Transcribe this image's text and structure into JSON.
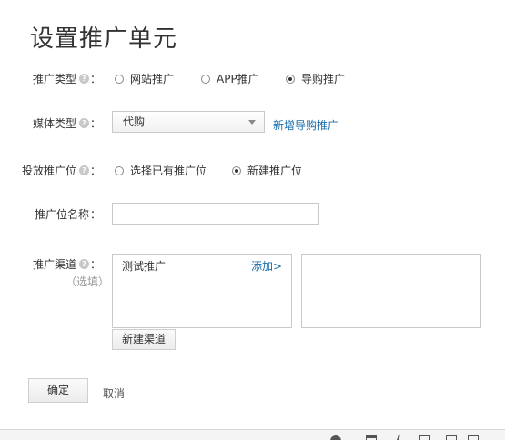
{
  "page_title": "设置推广单元",
  "promo_type": {
    "label": "推广类型",
    "options": [
      {
        "label": "网站推广",
        "checked": false
      },
      {
        "label": "APP推广",
        "checked": false
      },
      {
        "label": "导购推广",
        "checked": true
      }
    ]
  },
  "media_type": {
    "label": "媒体类型",
    "selected": "代购",
    "add_link": "新增导购推广"
  },
  "placement": {
    "label": "投放推广位",
    "options": [
      {
        "label": "选择已有推广位",
        "checked": false
      },
      {
        "label": "新建推广位",
        "checked": true
      }
    ]
  },
  "placement_name": {
    "label": "推广位名称",
    "value": ""
  },
  "channel": {
    "label": "推广渠道",
    "optional": "（选填）",
    "items": [
      "测试推广"
    ],
    "add_label": "添加>",
    "new_button": "新建渠道"
  },
  "actions": {
    "confirm": "确定",
    "cancel": "取消"
  },
  "colon": "：",
  "help_glyph": "?"
}
